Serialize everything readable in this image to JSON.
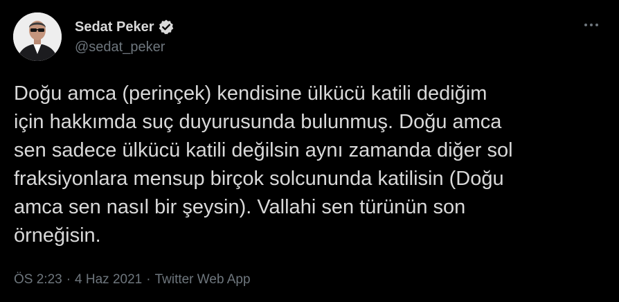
{
  "author": {
    "display_name": "Sedat Peker",
    "handle": "@sedat_peker",
    "verified": true,
    "verified_icon": "verified-badge-icon",
    "avatar": "profile-photo"
  },
  "menu": {
    "icon": "more-dots-icon"
  },
  "tweet": {
    "text": "Doğu amca (perinçek) kendisine ülkücü katili dediğim\niçin hakkımda suç duyurusunda bulunmuş. Doğu amca\nsen sadece ülkücü katili değilsin aynı zamanda diğer sol\nfraksiyonlara mensup birçok solcunundа katilisin (Doğu\namca sen nasıl bir şeysin). Vallahi sen türünün son\nörneğisin."
  },
  "meta": {
    "time": "ÖS 2:23",
    "separator": "·",
    "date": "4 Haz 2021",
    "source": "Twitter Web App"
  },
  "colors": {
    "background": "#000000",
    "text": "#d9d9d9",
    "secondary": "#6e767d"
  }
}
